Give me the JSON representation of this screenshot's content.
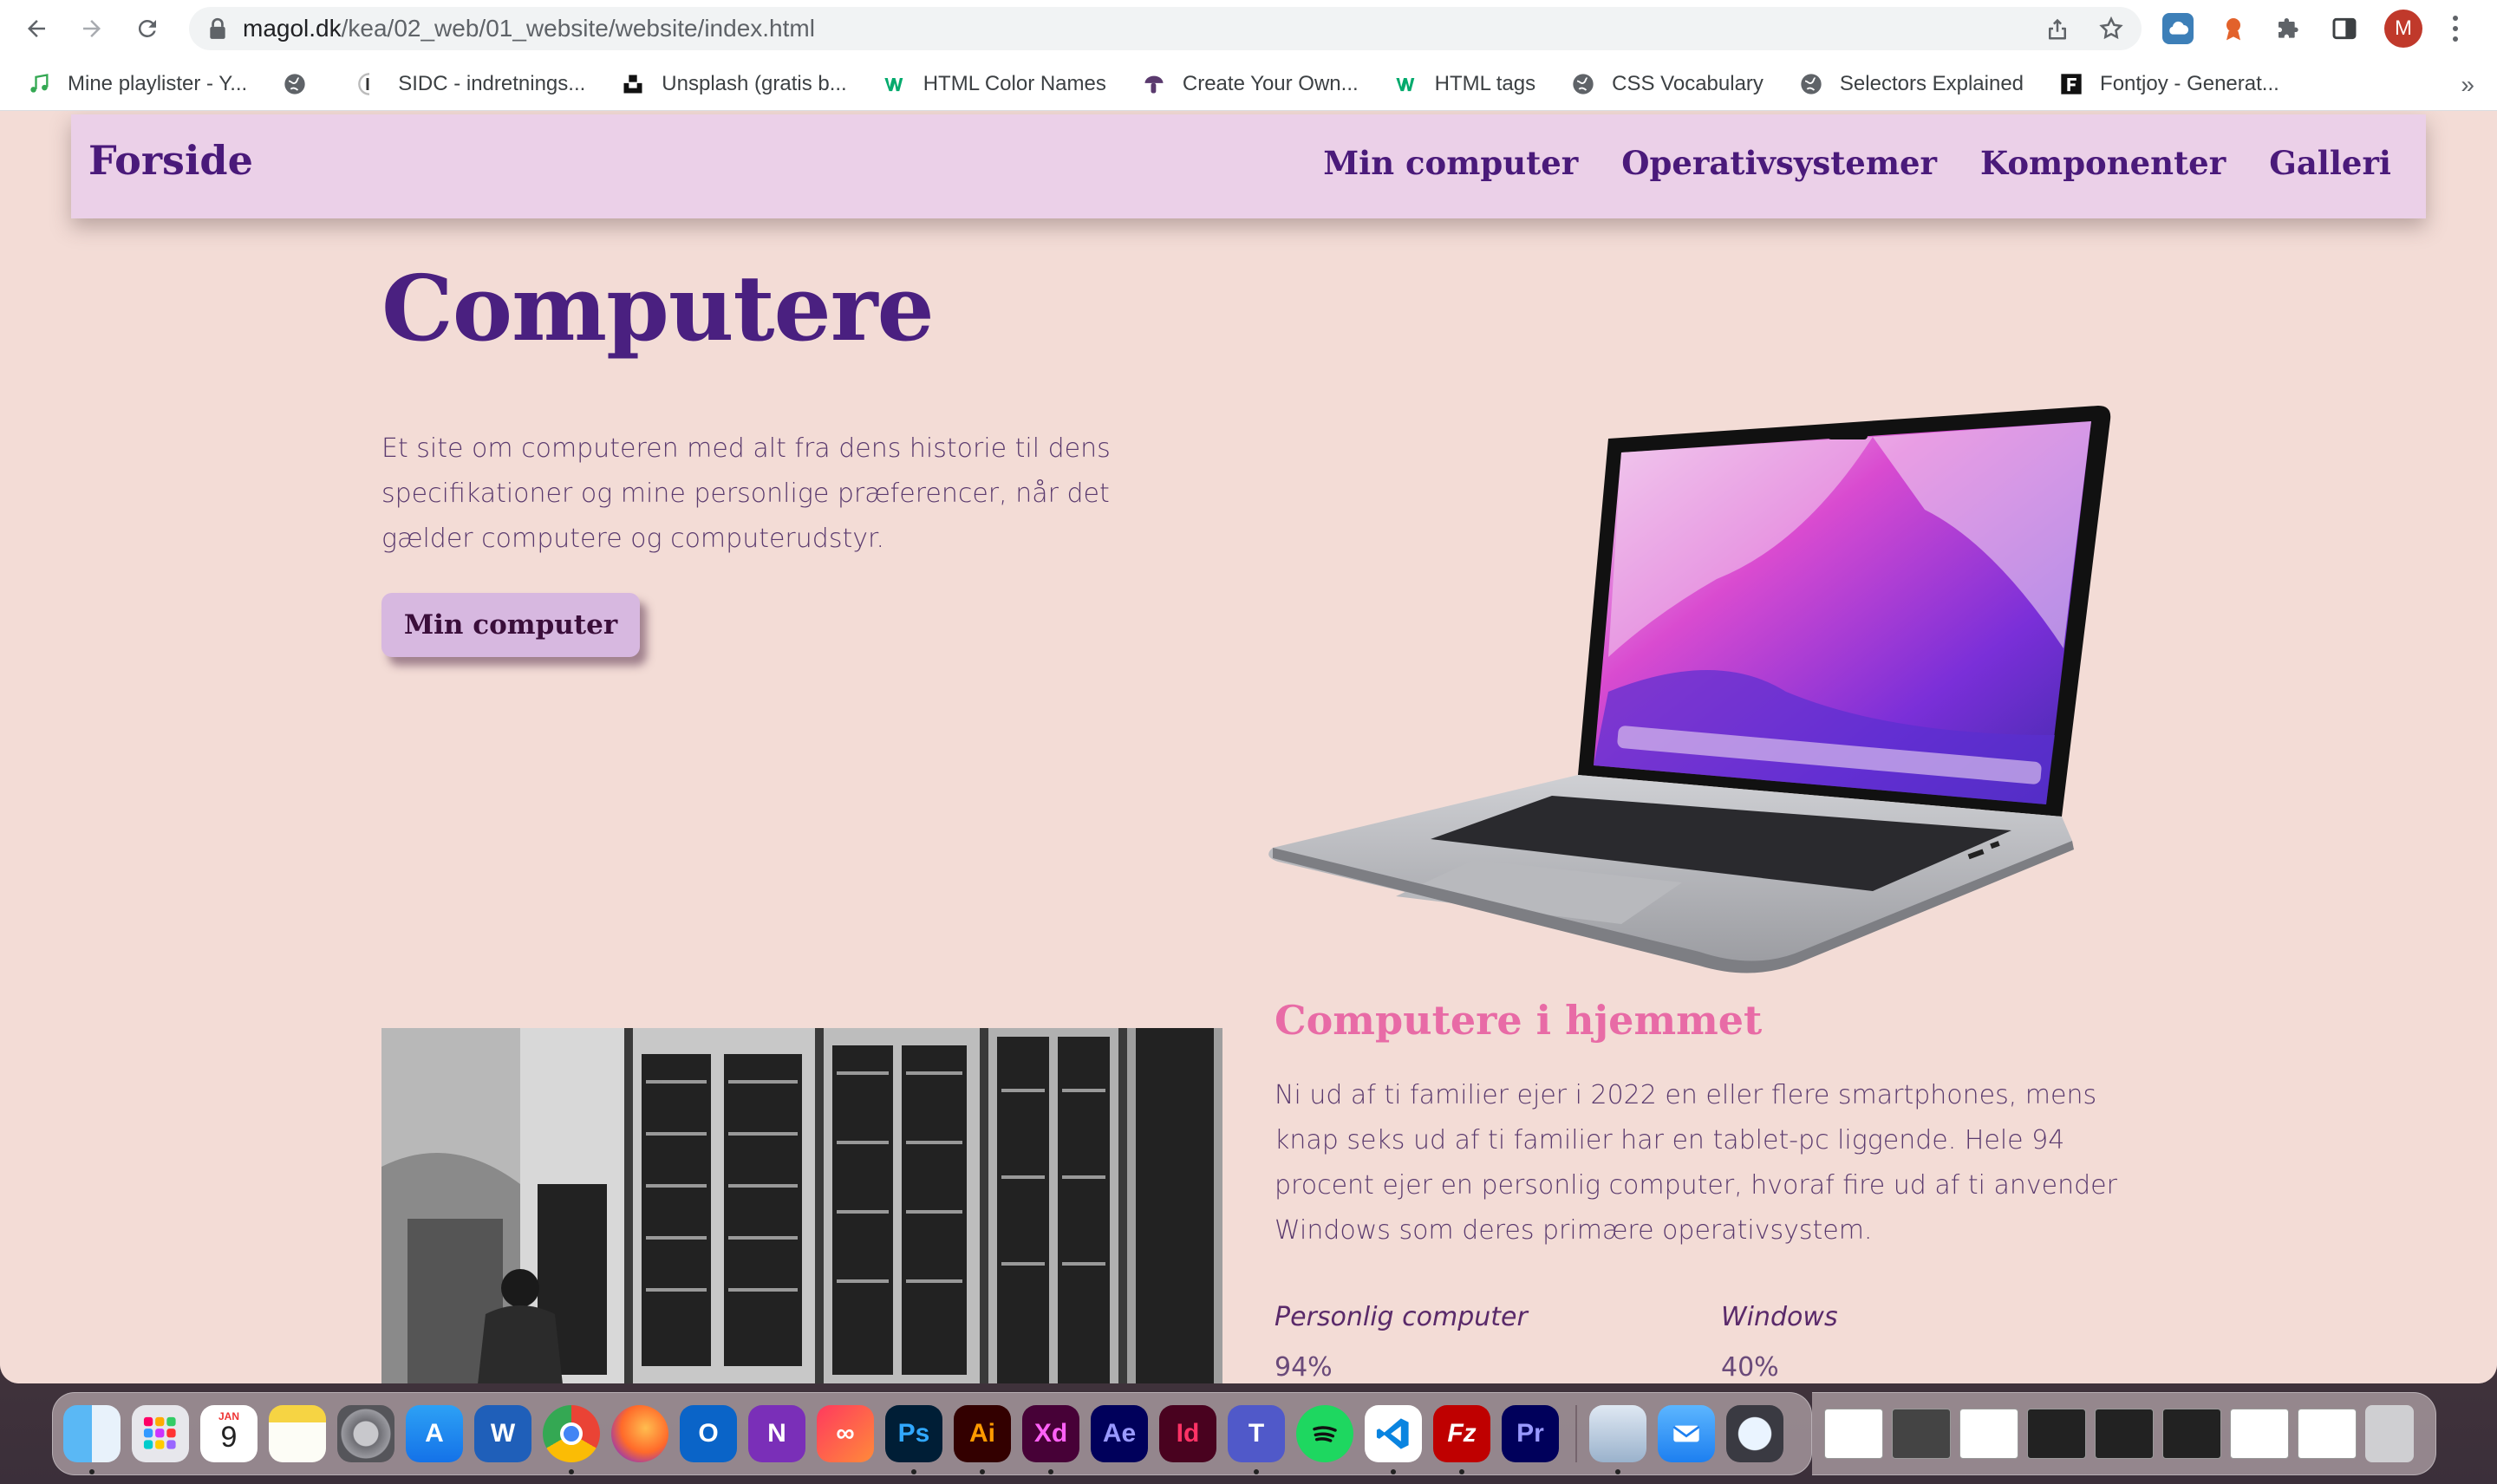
{
  "browser": {
    "url_host": "magol.dk",
    "url_path": "/kea/02_web/01_website/website/index.html",
    "profile_initial": "M",
    "bookmarks": [
      {
        "label": "Mine playlister - Y...",
        "icon": "music-note-icon"
      },
      {
        "label": "",
        "icon": "globe-icon"
      },
      {
        "label": "SIDC - indretnings...",
        "icon": "sidc-icon"
      },
      {
        "label": "Unsplash (gratis b...",
        "icon": "unsplash-icon"
      },
      {
        "label": "HTML Color Names",
        "icon": "w3schools-icon"
      },
      {
        "label": "Create Your Own...",
        "icon": "mushroom-icon"
      },
      {
        "label": "HTML tags",
        "icon": "w3schools-icon"
      },
      {
        "label": "CSS Vocabulary",
        "icon": "globe-icon"
      },
      {
        "label": "Selectors Explained",
        "icon": "globe-icon"
      },
      {
        "label": "Fontjoy - Generat...",
        "icon": "fontjoy-icon"
      }
    ],
    "bookmarks_more": "»"
  },
  "site": {
    "logo": "Forside",
    "nav": [
      "Min computer",
      "Operativsystemer",
      "Komponenter",
      "Galleri"
    ],
    "hero_title": "Computere",
    "hero_text": "Et site om computeren med alt fra dens historie til dens specifikationer og mine personlige præferencer, når det gælder computere og computerudstyr.",
    "hero_button": "Min computer",
    "section_title": "Computere i hjemmet",
    "section_text": "Ni ud af ti familier ejer i 2022 en eller flere smartphones, mens knap seks ud af ti familier har en tablet-pc liggende. Hele 94 procent ejer en personlig computer, hvoraf fire ud af ti anvender Windows som deres primære operativsystem.",
    "stats": [
      {
        "label": "Personlig computer",
        "value": "94%"
      },
      {
        "label": "Windows",
        "value": "40%"
      }
    ]
  },
  "colors": {
    "page_bg": "#f3dcd6",
    "header_bg": "#ebd0e8",
    "primary_purple": "#4a1a7a",
    "accent_pink": "#e86ba6",
    "button_bg": "#d7b8e0"
  },
  "dock": {
    "calendar_month": "JAN",
    "calendar_day": "9",
    "apps": [
      "Finder",
      "Launchpad",
      "Calendar",
      "Notes",
      "System Preferences",
      "App Store",
      "Word",
      "Chrome",
      "Firefox",
      "Outlook",
      "OneNote",
      "Creative Cloud",
      "Photoshop",
      "Illustrator",
      "XD",
      "After Effects",
      "InDesign",
      "Teams",
      "Spotify",
      "VS Code",
      "FileZilla",
      "Premiere Pro",
      "Preview",
      "Mail",
      "QuickTime"
    ],
    "app_labels": {
      "ps": "Ps",
      "ai": "Ai",
      "xd": "Xd",
      "ae": "Ae",
      "id": "Id",
      "pr": "Pr",
      "fz": "Fz"
    }
  }
}
